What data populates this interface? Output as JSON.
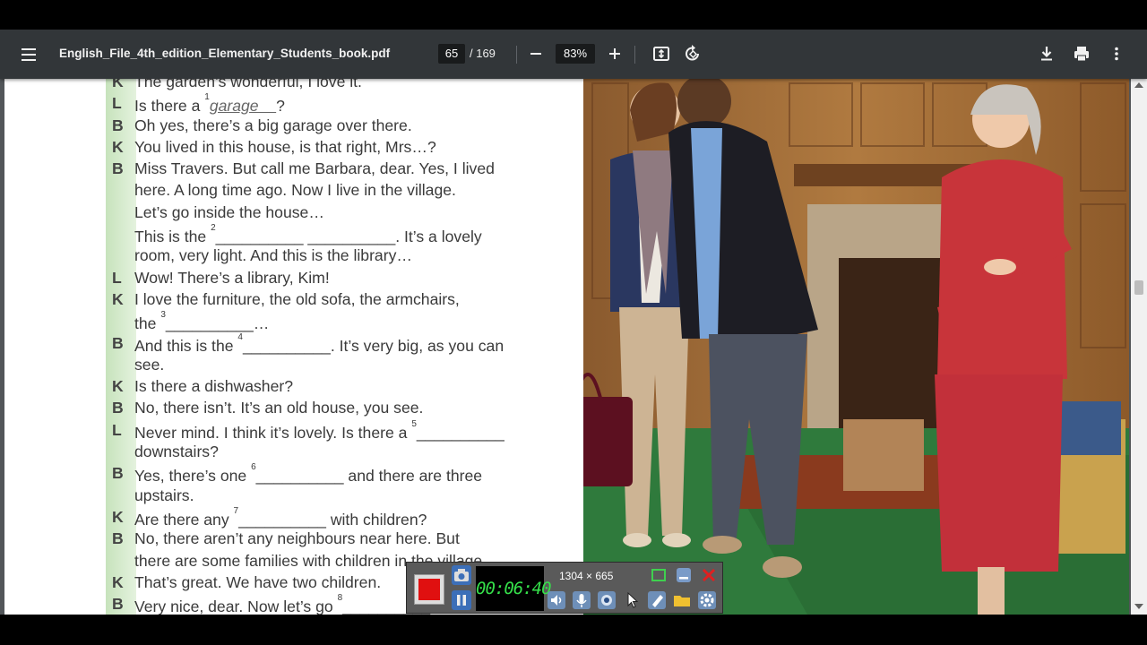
{
  "toolbar": {
    "file_name": "English_File_4th_edition_Elementary_Students_book.pdf",
    "current_page": "65",
    "total_pages": "/ 169",
    "zoom": "83%"
  },
  "dialogue": [
    {
      "speaker": "K",
      "parts": [
        "The garden’s wonderful, I love it."
      ]
    },
    {
      "speaker": "L",
      "parts": [
        "Is there a ",
        {
          "sup": "1"
        },
        {
          "u": "garage"
        },
        "?"
      ]
    },
    {
      "speaker": "B",
      "parts": [
        "Oh yes, there’s a big garage over there."
      ]
    },
    {
      "speaker": "K",
      "parts": [
        "You lived in this house, is that right, Mrs…?"
      ]
    },
    {
      "speaker": "B",
      "parts": [
        "Miss Travers. But call me Barbara, dear. Yes, I lived"
      ]
    },
    {
      "speaker": "",
      "parts": [
        "here. A long time ago. Now I live in the village."
      ]
    },
    {
      "speaker": "",
      "parts": [
        "Let’s go inside the house…"
      ]
    },
    {
      "speaker": "",
      "parts": [
        "This is the ",
        {
          "sup": "2"
        },
        "__________ __________. It’s a lovely"
      ]
    },
    {
      "speaker": "",
      "parts": [
        "room, very light. And this is the library…"
      ]
    },
    {
      "speaker": "L",
      "parts": [
        "Wow! There’s a library, Kim!"
      ]
    },
    {
      "speaker": "K",
      "parts": [
        "I love the furniture, the old sofa, the armchairs,"
      ]
    },
    {
      "speaker": "",
      "parts": [
        "the ",
        {
          "sup": "3"
        },
        "__________…"
      ]
    },
    {
      "speaker": "B",
      "parts": [
        "And this is the ",
        {
          "sup": "4"
        },
        "__________. It’s very big, as you can"
      ]
    },
    {
      "speaker": "",
      "parts": [
        "see."
      ]
    },
    {
      "speaker": "K",
      "parts": [
        "Is there a dishwasher?"
      ]
    },
    {
      "speaker": "B",
      "parts": [
        "No, there isn’t. It’s an old house, you see."
      ]
    },
    {
      "speaker": "L",
      "parts": [
        "Never mind. I think it’s lovely. Is there a ",
        {
          "sup": "5"
        },
        "__________"
      ]
    },
    {
      "speaker": "",
      "parts": [
        "downstairs?"
      ]
    },
    {
      "speaker": "B",
      "parts": [
        "Yes, there’s one ",
        {
          "sup": "6"
        },
        "__________ and there are three"
      ]
    },
    {
      "speaker": "",
      "parts": [
        "upstairs."
      ]
    },
    {
      "speaker": "K",
      "parts": [
        "Are there any ",
        {
          "sup": "7"
        },
        "__________ with children?"
      ]
    },
    {
      "speaker": "B",
      "parts": [
        "No, there aren’t any neighbours near here. But"
      ]
    },
    {
      "speaker": "",
      "parts": [
        "there are some families with children in the village."
      ]
    },
    {
      "speaker": "K",
      "parts": [
        "That’s great. We have two children."
      ]
    },
    {
      "speaker": "B",
      "parts": [
        "Very nice, dear. Now let’s go ",
        {
          "sup": "8"
        },
        "__________"
      ]
    }
  ],
  "recorder": {
    "timer": "00:06:40",
    "size": "1304 × 665"
  }
}
